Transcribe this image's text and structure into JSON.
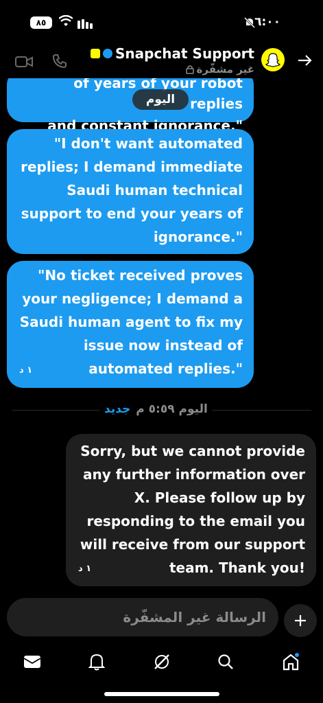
{
  "status_bar": {
    "battery": "٨٥",
    "time": "٦:٠٠"
  },
  "header": {
    "title": "Snapchat Support",
    "subtitle": "غير مشفّرة",
    "icons": [
      "video-icon",
      "phone-icon",
      "lock-icon",
      "snapchat-ghost-icon",
      "arrow-right-icon",
      "snap-badge-icon",
      "verified-badge-icon"
    ]
  },
  "messages": [
    {
      "type": "sent",
      "lines": [
        "of years of your robot replies",
        "and constant ignorance.\""
      ]
    },
    {
      "type": "sent",
      "lines": [
        "\"I don't want automated",
        "replies; I demand immediate",
        "Saudi human technical",
        "support to end your years of",
        "ignorance.\""
      ]
    },
    {
      "type": "sent",
      "lines": [
        "\"No ticket received proves",
        "your negligence; I demand a",
        "Saudi human agent to fix my",
        "issue now instead of",
        "automated replies.\""
      ],
      "time": "١ د"
    }
  ],
  "today_pill": "اليوم",
  "date_divider": {
    "new": "جديد",
    "date": "اليوم ٥:٥٩ م"
  },
  "received": {
    "lines": [
      "Sorry, but we cannot provide",
      "any further information over",
      "X. Please follow up by",
      "responding to the email you",
      "will receive from our support",
      "team. Thank you!"
    ],
    "time": "١ د"
  },
  "composer": {
    "placeholder": "الرسالة غير المشفّرة"
  },
  "nav": [
    "mail-icon",
    "bell-icon",
    "grok-icon",
    "search-icon",
    "home-icon"
  ],
  "colors": {
    "accent": "#1d9bf0",
    "snap_yellow": "#fffc00",
    "bubble_gray": "#1f1f1f"
  }
}
